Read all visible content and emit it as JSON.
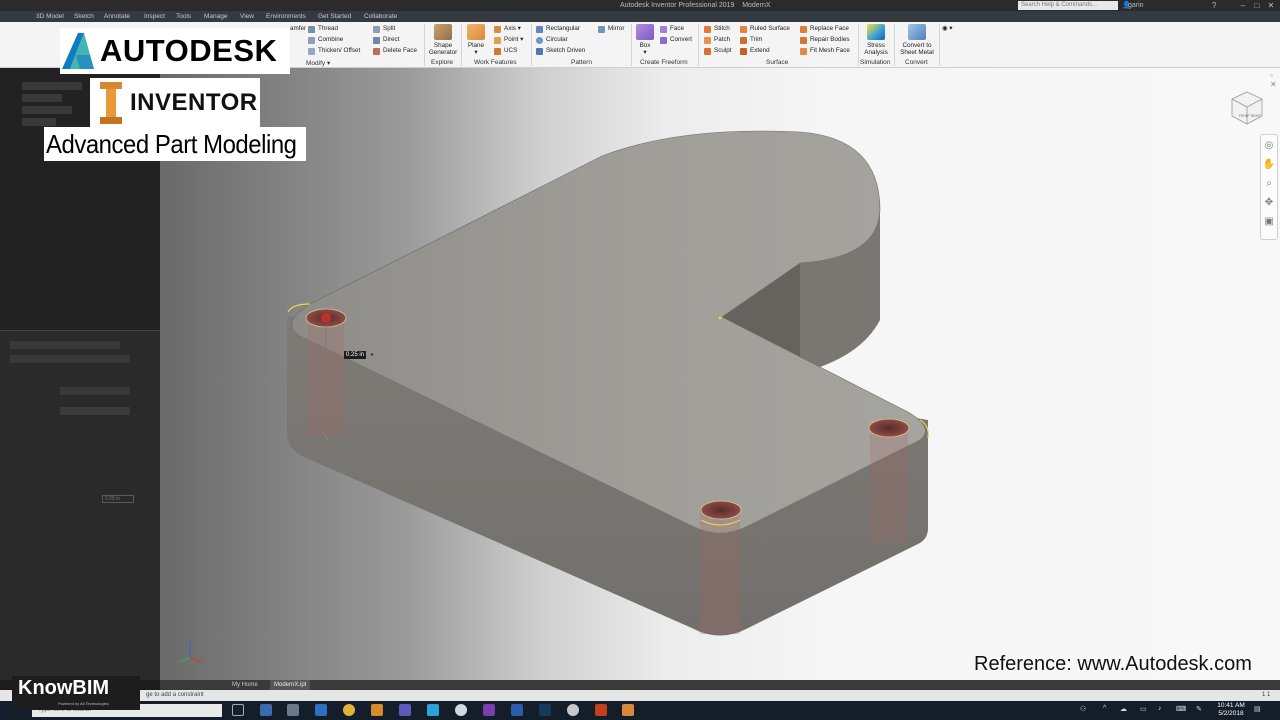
{
  "window": {
    "title": "Autodesk Inventor Professional 2019",
    "document": "ModernX",
    "search_placeholder": "Search Help & Commands...",
    "user": "garin"
  },
  "tabs": [
    "3D Model",
    "Sketch",
    "Annotate",
    "Inspect",
    "Tools",
    "Manage",
    "View",
    "Environments",
    "Get Started",
    "Collaborate"
  ],
  "ribbon": {
    "modify": {
      "label": "Modify",
      "items": [
        "Thread",
        "Combine",
        "Thicken/ Offset",
        "Split",
        "Direct",
        "Delete Face"
      ],
      "partial": "amfer"
    },
    "explore": {
      "label": "Explore",
      "button": "Shape Generator"
    },
    "work_features": {
      "label": "Work Features",
      "plane": "Plane",
      "items": [
        "Axis",
        "Point",
        "UCS"
      ]
    },
    "pattern": {
      "label": "Pattern",
      "items": [
        "Rectangular",
        "Circular",
        "Sketch Driven",
        "Mirror"
      ]
    },
    "create_freeform": {
      "label": "Create Freeform",
      "box": "Box",
      "items": [
        "Face",
        "Convert"
      ]
    },
    "surface": {
      "label": "Surface",
      "items": [
        "Stitch",
        "Patch",
        "Sculpt",
        "Ruled Surface",
        "Trim",
        "Extend",
        "Replace Face",
        "Repair Bodies",
        "Fit Mesh Face"
      ]
    },
    "simulation": {
      "label": "Simulation",
      "button": "Stress Analysis"
    },
    "convert": {
      "label": "Convert",
      "button": "Convert to Sheet Metal"
    }
  },
  "viewport": {
    "dimension_value": "0.25 in",
    "viewcube_faces": [
      "FRONT",
      "RIGHT"
    ]
  },
  "left_panel": {
    "dimension_value": "0.25 in"
  },
  "doc_tabs": [
    "My Home",
    "ModernX.ipt"
  ],
  "status": {
    "text": "ge to add a constraint",
    "count": "1   1"
  },
  "overlays": {
    "autodesk": "AUTODESK",
    "inventor": "INVENTOR",
    "subtitle": "Advanced Part Modeling",
    "reference": "Reference: www.Autodesk.com",
    "knowbim": "KnowBIM"
  },
  "taskbar": {
    "search": "Type here to search",
    "time": "10:41 AM",
    "date": "5/2/2018"
  },
  "colors": {
    "accent": "#3c7dd9",
    "part_top": "#a4a29d",
    "part_side": "#7c7975",
    "hole": "#8a3a36"
  }
}
